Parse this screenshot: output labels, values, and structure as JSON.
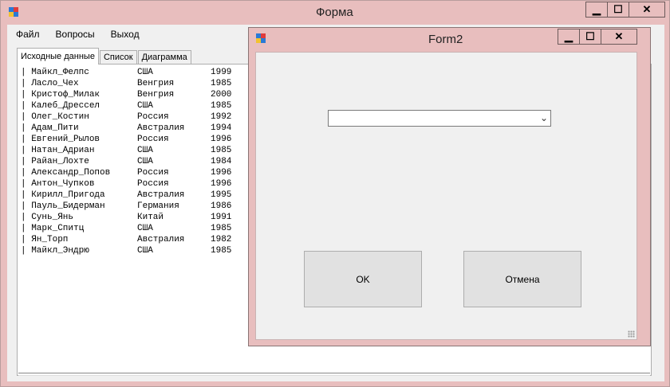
{
  "main_window": {
    "title": "Форма",
    "buttons": {
      "minimize": "▁",
      "maximize": "☐",
      "close": "✕"
    }
  },
  "menu": [
    "Файл",
    "Вопросы",
    "Выход"
  ],
  "tabs": [
    "Исходные данные",
    "Список",
    "Диаграмма"
  ],
  "table": {
    "rows": [
      [
        "| Майкл_Фелпс",
        "США",
        "1999"
      ],
      [
        "| Ласло_Чех",
        "Венгрия",
        "1985"
      ],
      [
        "| Кристоф_Милак",
        "Венгрия",
        "2000"
      ],
      [
        "| Калеб_Дрессел",
        "США",
        "1985"
      ],
      [
        "| Олег_Костин",
        "Россия",
        "1992"
      ],
      [
        "| Адам_Пити",
        "Австралия",
        "1994"
      ],
      [
        "| Евгений_Рылов",
        "Россия",
        "1996"
      ],
      [
        "| Натан_Адриан",
        "США",
        "1985"
      ],
      [
        "| Райан_Лохте",
        "США",
        "1984"
      ],
      [
        "| Александр_Попов",
        "Россия",
        "1996"
      ],
      [
        "| Антон_Чупков",
        "Россия",
        "1996"
      ],
      [
        "| Кирилл_Пригода",
        "Австралия",
        "1995"
      ],
      [
        "| Пауль_Бидерман",
        "Германия",
        "1986"
      ],
      [
        "| Сунь_Янь",
        "Китай",
        "1991"
      ],
      [
        "| Марк_Спитц",
        "США",
        "1985"
      ],
      [
        "| Ян_Торп",
        "Австралия",
        "1982"
      ],
      [
        "| Майкл_Эндрю",
        "США",
        "1985"
      ]
    ]
  },
  "dialog": {
    "title": "Form2",
    "buttons": {
      "minimize": "▁",
      "maximize": "☐",
      "close": "✕"
    },
    "combo_value": "",
    "ok_label": "OK",
    "cancel_label": "Отмена"
  },
  "colors": {
    "frame": "#e8bebe",
    "client": "#f0f0f0",
    "button": "#e1e1e1"
  },
  "icons": [
    "app-icon",
    "minimize-icon",
    "maximize-icon",
    "close-icon",
    "dropdown-arrow-icon",
    "size-grip-icon"
  ]
}
